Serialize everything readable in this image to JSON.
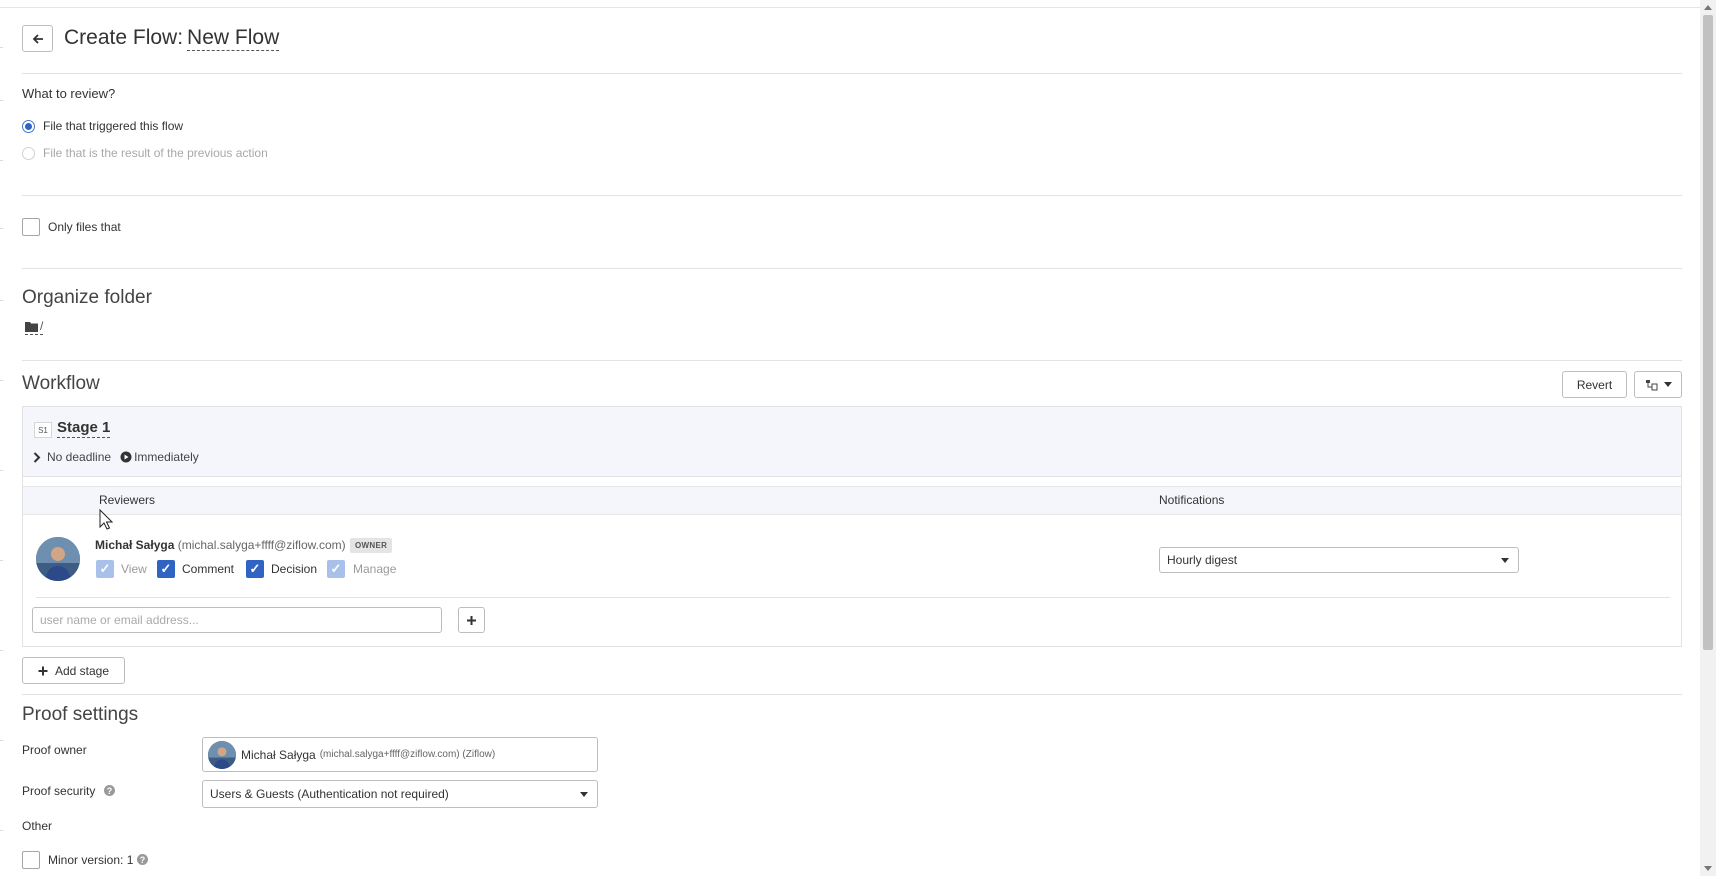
{
  "header": {
    "title_prefix": "Create Flow:",
    "flow_name": "New Flow"
  },
  "review": {
    "heading": "What to review?",
    "options": [
      {
        "label": "File that triggered this flow",
        "selected": true,
        "disabled": false
      },
      {
        "label": "File that is the result of the previous action",
        "selected": false,
        "disabled": true
      }
    ]
  },
  "filter": {
    "only_files_label": "Only files that"
  },
  "organize": {
    "title": "Organize folder",
    "path": "/"
  },
  "workflow": {
    "title": "Workflow",
    "revert_label": "Revert",
    "stage": {
      "badge": "S1",
      "name": "Stage 1",
      "deadline": "No deadline",
      "start": "Immediately"
    },
    "columns": {
      "reviewers": "Reviewers",
      "notifications": "Notifications"
    },
    "reviewer": {
      "name": "Michał Sałyga",
      "email": "(michal.salyga+ffff@ziflow.com)",
      "badge": "OWNER",
      "permissions": [
        {
          "label": "View",
          "checked": true,
          "locked": true
        },
        {
          "label": "Comment",
          "checked": true,
          "locked": false
        },
        {
          "label": "Decision",
          "checked": true,
          "locked": false
        },
        {
          "label": "Manage",
          "checked": true,
          "locked": true
        }
      ],
      "notification": "Hourly digest"
    },
    "add_reviewer_placeholder": "user name or email address...",
    "add_stage_label": "Add stage"
  },
  "proof": {
    "title": "Proof settings",
    "owner_label": "Proof owner",
    "owner_name": "Michał Sałyga",
    "owner_detail": "(michal.salyga+ffff@ziflow.com) (Ziflow)",
    "security_label": "Proof security",
    "security_value": "Users & Guests (Authentication not required)",
    "other_label": "Other",
    "minor_version_label": "Minor version: 1"
  },
  "colors": {
    "accent": "#2f63c4",
    "header_bg": "#f4f6fb"
  }
}
